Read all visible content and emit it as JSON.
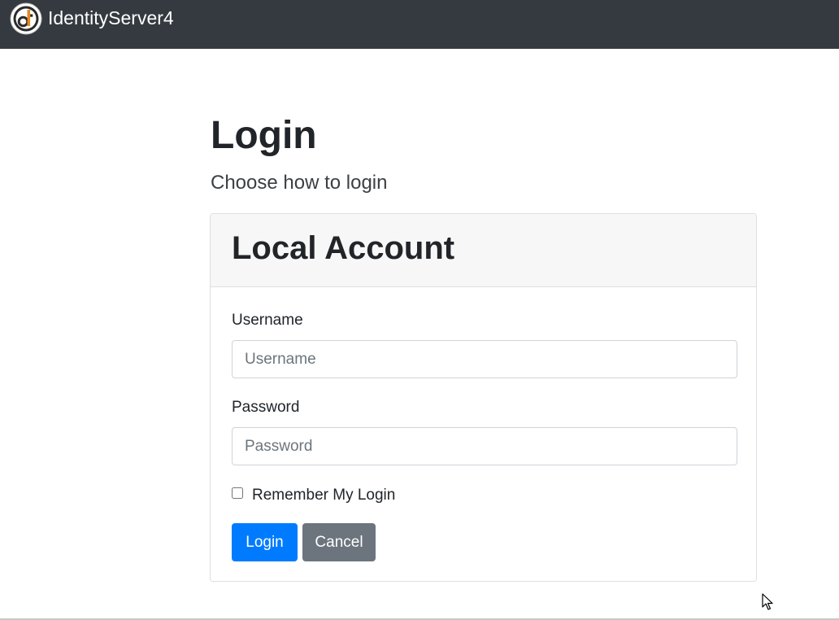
{
  "navbar": {
    "brand_name": "IdentityServer4",
    "logo_icon": "identityserver-logo-icon",
    "background_color": "#343a40"
  },
  "page": {
    "title": "Login",
    "subtitle": "Choose how to login"
  },
  "local_account": {
    "header": "Local Account",
    "username": {
      "label": "Username",
      "placeholder": "Username",
      "value": ""
    },
    "password": {
      "label": "Password",
      "placeholder": "Password",
      "value": ""
    },
    "remember": {
      "label": "Remember My Login",
      "checked": false
    },
    "buttons": {
      "login": "Login",
      "cancel": "Cancel"
    }
  },
  "colors": {
    "primary": "#007bff",
    "secondary": "#6c757d",
    "card_header_bg": "#f7f7f7"
  }
}
